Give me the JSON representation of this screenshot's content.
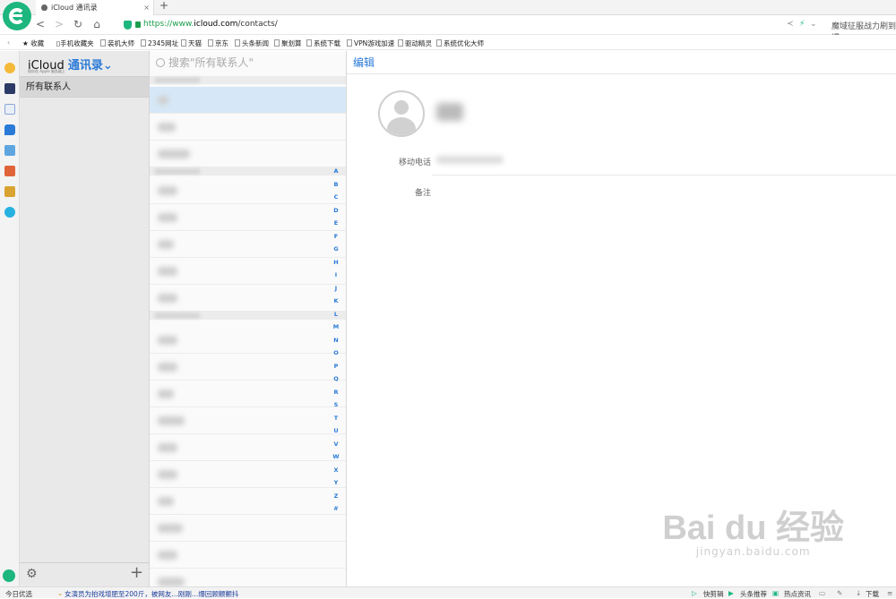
{
  "browser": {
    "tab_title": "iCloud 通讯录",
    "tab_close": "×",
    "new_tab": "+",
    "url_scheme": "https://www.",
    "url_host": "icloud.com",
    "url_path": "/contacts/",
    "right_text": "魔域征服战力刷到爆",
    "back": "<",
    "forward": ">",
    "reload": "↻",
    "home": "⌂"
  },
  "bookmarks": [
    "收藏",
    "手机收藏夹",
    "装机大师",
    "2345网址",
    "天猫",
    "京东",
    "头条新闻",
    "聚划算",
    "系统下载",
    "VPN游戏加速",
    "驱动精灵",
    "系统优化大师"
  ],
  "app": {
    "title_prefix": "iCloud",
    "title_main": "通讯录",
    "title_caret": "⌄",
    "subtitle": "保存在 Apple 服务器上",
    "groups": [
      "所有联系人"
    ],
    "settings_icon": "⚙",
    "add_icon": "+",
    "search_placeholder": "搜索\"所有联系人\"",
    "index_letters": [
      "A",
      "B",
      "C",
      "D",
      "E",
      "F",
      "G",
      "H",
      "I",
      "J",
      "K",
      "L",
      "M",
      "N",
      "O",
      "P",
      "Q",
      "R",
      "S",
      "T",
      "U",
      "V",
      "W",
      "X",
      "Y",
      "Z",
      "#"
    ],
    "detail": {
      "edit_label": "编辑",
      "field_phone": "移动电话",
      "field_notes": "备注"
    }
  },
  "statusbar": {
    "left": "今日优选",
    "news": "女演员为拍戏增肥至200斤，被网友…刚刚…爆回顾颤颤抖",
    "items": [
      "快剪辑",
      "头条推荐",
      "热点资讯",
      "下载"
    ]
  },
  "watermark": {
    "logo": "Bai du 经验",
    "url": "jingyan.baidu.com"
  },
  "colors": {
    "accent": "#2a7ad8",
    "brand_green": "#1cb67e",
    "selected_row": "#d6e8f7"
  }
}
